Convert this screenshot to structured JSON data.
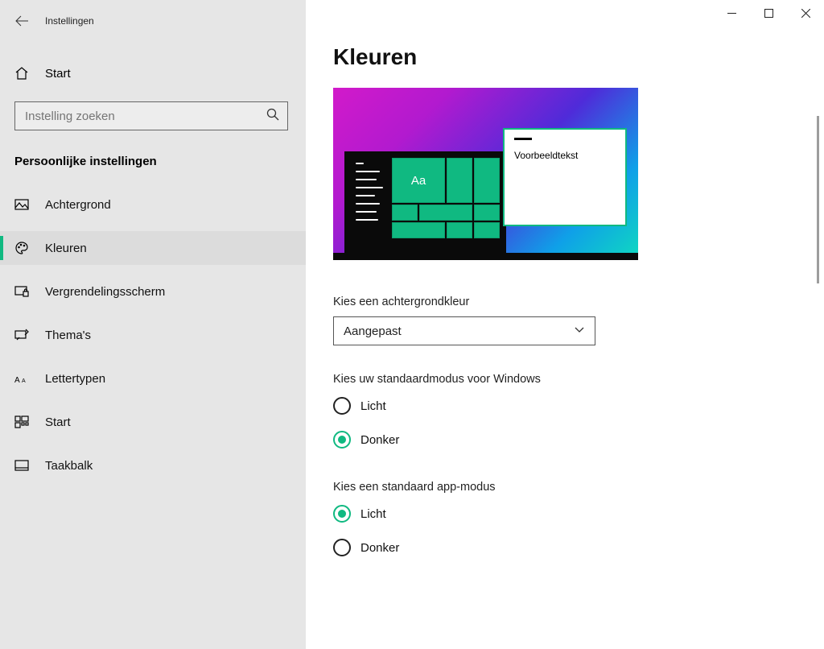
{
  "app_title": "Instellingen",
  "titlebar": {
    "minimize": "minimize",
    "maximize": "maximize",
    "close": "close"
  },
  "sidebar": {
    "home_label": "Start",
    "search_placeholder": "Instelling zoeken",
    "section_heading": "Persoonlijke instellingen",
    "items": [
      {
        "label": "Achtergrond",
        "icon": "picture"
      },
      {
        "label": "Kleuren",
        "icon": "palette",
        "active": true
      },
      {
        "label": "Vergrendelingsscherm",
        "icon": "lock-screen"
      },
      {
        "label": "Thema's",
        "icon": "paintbrush"
      },
      {
        "label": "Lettertypen",
        "icon": "font"
      },
      {
        "label": "Start",
        "icon": "start-grid"
      },
      {
        "label": "Taakbalk",
        "icon": "taskbar"
      }
    ]
  },
  "page": {
    "title": "Kleuren",
    "preview": {
      "tile_text": "Aa",
      "sample_text": "Voorbeeldtekst"
    },
    "color_mode": {
      "label": "Kies een achtergrondkleur",
      "selected": "Aangepast"
    },
    "windows_mode": {
      "label": "Kies uw standaardmodus voor Windows",
      "options": [
        "Licht",
        "Donker"
      ],
      "selected": "Donker"
    },
    "app_mode": {
      "label": "Kies een standaard app-modus",
      "options": [
        "Licht",
        "Donker"
      ],
      "selected": "Licht"
    }
  },
  "colors": {
    "accent": "#10b981"
  }
}
